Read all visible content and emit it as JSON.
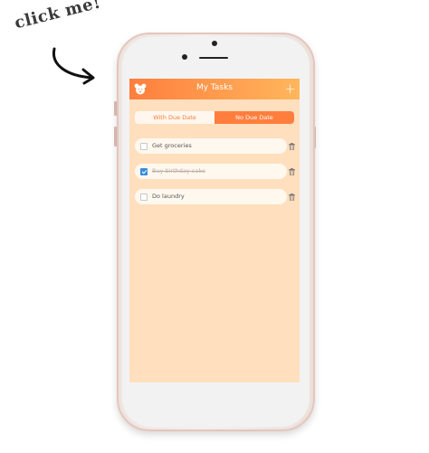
{
  "callout": {
    "text": "click me!"
  },
  "header": {
    "title": "My Tasks",
    "logo_icon": "bear-icon",
    "add_icon": "plus-icon"
  },
  "tabs": [
    {
      "label": "With Due Date",
      "active": false
    },
    {
      "label": "No Due Date",
      "active": true
    }
  ],
  "tasks": [
    {
      "label": "Get groceries",
      "done": false
    },
    {
      "label": "Buy birthday cake",
      "done": true
    },
    {
      "label": "Do laundry",
      "done": false
    }
  ],
  "colors": {
    "accent": "#ff7e3d",
    "accent_light": "#ffb65c",
    "screen_bg": "#ffdfbe",
    "row_bg": "#fff8ef",
    "checked": "#3a8ddb"
  }
}
